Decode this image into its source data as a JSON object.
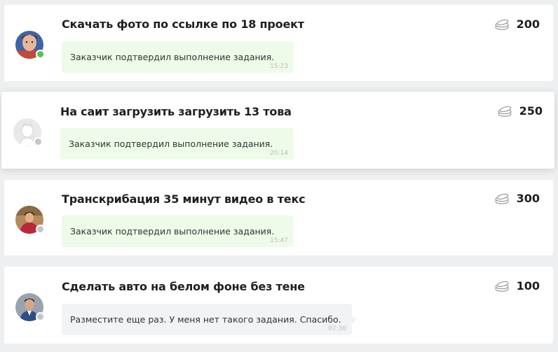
{
  "colors": {
    "background": "#eeeff0",
    "card": "#ffffff",
    "bubble_green": "#eefbe9",
    "bubble_gray": "#f2f3f4",
    "online": "#5cc14a",
    "offline": "#c6c6c6"
  },
  "tasks": [
    {
      "title": "Скачать фото по ссылке по 18 проект",
      "price": "200",
      "price_icon": "coins-icon",
      "message": "Заказчик подтвердил выполнение задания.",
      "time": "15:23",
      "status": "online"
    },
    {
      "title": "На саит загрузить загрузить 13 това",
      "price": "250",
      "price_icon": "coins-icon",
      "message": "Заказчик подтвердил выполнение задания.",
      "time": "20:14",
      "status": "offline"
    },
    {
      "title": "Транскрибация 35 минут видео в текс",
      "price": "300",
      "price_icon": "coins-icon",
      "message": "Заказчик подтвердил выполнение задания.",
      "time": "15:47",
      "status": "offline"
    },
    {
      "title": "Сделать авто на белом фоне без тене",
      "price": "100",
      "price_icon": "coins-icon",
      "message": "Разместите еще раз. У меня нет такого задания. Спасибо.",
      "time": "07:30",
      "status": "offline"
    }
  ]
}
